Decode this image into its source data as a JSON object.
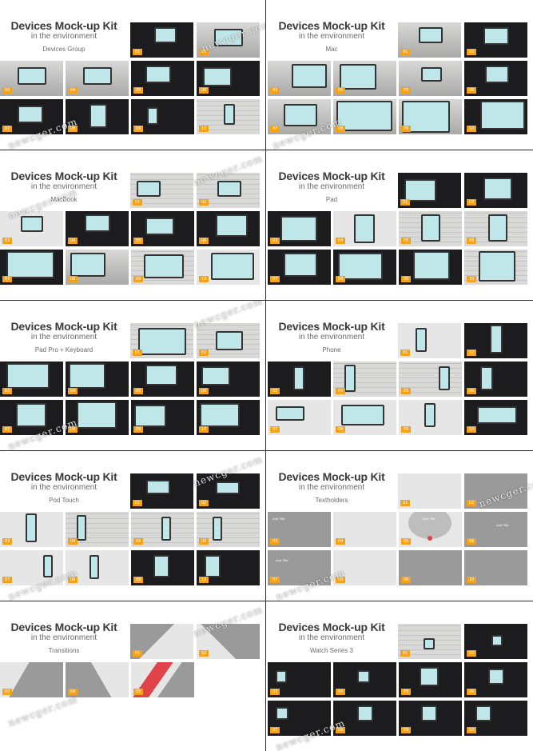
{
  "header": {
    "title": "Devices Mock-up Kit",
    "subtitle": "in the environment"
  },
  "watermark": "newcger.com",
  "panels": [
    {
      "category": "Devices Group"
    },
    {
      "category": "Mac"
    },
    {
      "category": "MacBook"
    },
    {
      "category": "Pad"
    },
    {
      "category": "Pad Pro + Keyboard"
    },
    {
      "category": "Phone"
    },
    {
      "category": "Pod Touch"
    },
    {
      "category": "Textholders"
    },
    {
      "category": "Transitions"
    },
    {
      "category": "Watch Series 3"
    }
  ],
  "screen_labels": {
    "pad": "Pad",
    "desktop": "Desktop"
  },
  "textholders": {
    "heading": "Add Title"
  },
  "colors": {
    "divider": "#2a2a2a",
    "badge": "#f4a21a",
    "screen": "#bfe6e8",
    "accent_red": "#e0444a"
  }
}
